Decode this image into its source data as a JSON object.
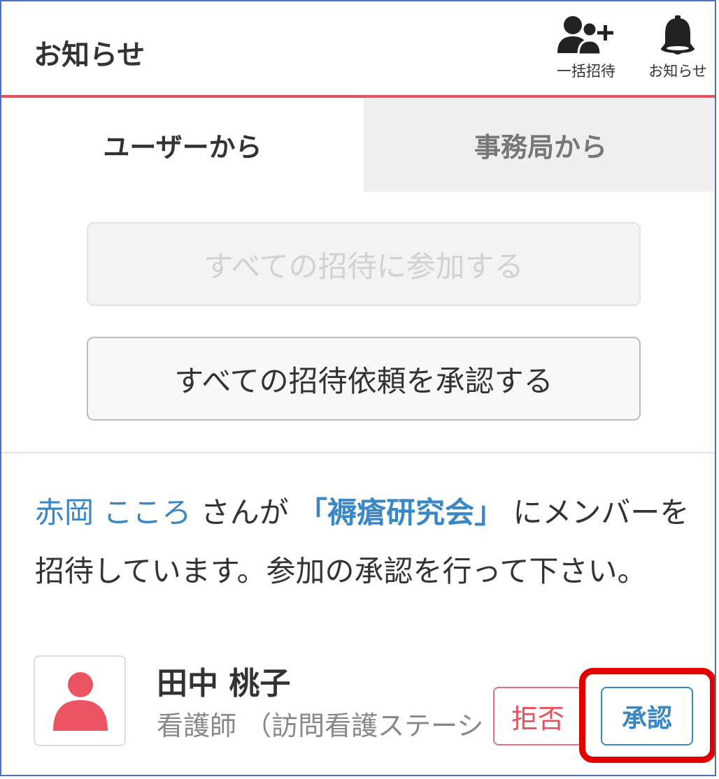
{
  "header": {
    "title": "お知らせ",
    "invite_label": "一括招待",
    "notify_label": "お知らせ"
  },
  "tabs": [
    {
      "label": "ユーザーから",
      "active": true
    },
    {
      "label": "事務局から",
      "active": false
    }
  ],
  "actions": {
    "join_all_label": "すべての招待に参加する",
    "join_all_disabled": true,
    "approve_all_label": "すべての招待依頼を承認する"
  },
  "message": {
    "inviter": "赤岡 こころ",
    "text1": " さんが ",
    "group": "「褥瘡研究会」",
    "text2": " にメンバーを招待しています。参加の承認を行って下さい。"
  },
  "invitee": {
    "name": "田中 桃子",
    "role": "看護師 （訪問看護ステーション",
    "reject_label": "拒否",
    "accept_label": "承認"
  },
  "colors": {
    "accent_red": "#e8505b",
    "link_blue": "#3a87c8",
    "frame_blue": "#4a72c4",
    "highlight_red": "#e00000"
  },
  "icons": {
    "invite": "add-users-icon",
    "notify": "bell-icon",
    "avatar": "person-icon"
  }
}
